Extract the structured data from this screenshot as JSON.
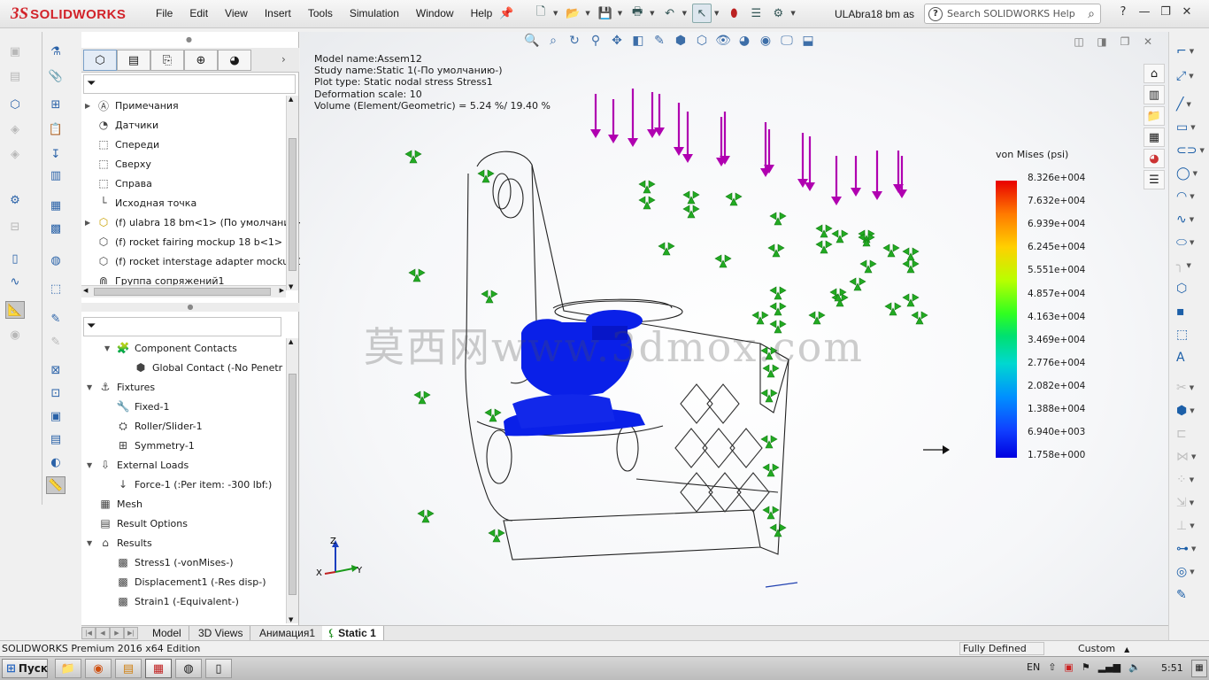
{
  "app": {
    "logo_ds": "3S",
    "logo_text": "SOLIDWORKS",
    "doc_title": "ULAbra18 bm as",
    "search_placeholder": "Search SOLIDWORKS Help"
  },
  "menu": [
    "File",
    "Edit",
    "View",
    "Insert",
    "Tools",
    "Simulation",
    "Window",
    "Help"
  ],
  "feature_tree": {
    "items": [
      {
        "label": "Примечания",
        "icon": "annotations-icon"
      },
      {
        "label": "Датчики",
        "icon": "sensors-icon"
      },
      {
        "label": "Спереди",
        "icon": "plane-icon"
      },
      {
        "label": "Сверху",
        "icon": "plane-icon"
      },
      {
        "label": "Справа",
        "icon": "plane-icon"
      },
      {
        "label": "Исходная точка",
        "icon": "origin-icon"
      },
      {
        "label": "(f) ulabra 18 bm<1> (По умолчанию<",
        "icon": "part-icon"
      },
      {
        "label": "(f) rocket fairing mockup 18 b<1> -> (",
        "icon": "part-icon"
      },
      {
        "label": "(f) rocket interstage adapter mockup 1",
        "icon": "part-icon"
      },
      {
        "label": "Группа сопряжений1",
        "icon": "mates-icon"
      }
    ]
  },
  "sim_tree": {
    "items": [
      {
        "label": "Component Contacts",
        "indent": 1,
        "expand": "▼"
      },
      {
        "label": "Global Contact (-No Penetr",
        "indent": 2,
        "expand": ""
      },
      {
        "label": "Fixtures",
        "indent": 0,
        "expand": "▼"
      },
      {
        "label": "Fixed-1",
        "indent": 1,
        "expand": ""
      },
      {
        "label": "Roller/Slider-1",
        "indent": 1,
        "expand": ""
      },
      {
        "label": "Symmetry-1",
        "indent": 1,
        "expand": ""
      },
      {
        "label": "External Loads",
        "indent": 0,
        "expand": "▼"
      },
      {
        "label": "Force-1 (:Per item: -300 lbf:)",
        "indent": 1,
        "expand": ""
      },
      {
        "label": "Mesh",
        "indent": 0,
        "expand": ""
      },
      {
        "label": "Result Options",
        "indent": 0,
        "expand": ""
      },
      {
        "label": "Results",
        "indent": 0,
        "expand": "▼"
      },
      {
        "label": "Stress1 (-vonMises-)",
        "indent": 1,
        "expand": ""
      },
      {
        "label": "Displacement1 (-Res disp-)",
        "indent": 1,
        "expand": ""
      },
      {
        "label": "Strain1 (-Equivalent-)",
        "indent": 1,
        "expand": ""
      }
    ]
  },
  "study_info": {
    "model_name": "Model name:Assem12",
    "study_name": "Study name:Static 1(-По умолчанию-)",
    "plot_type": "Plot type: Static nodal stress Stress1",
    "deformation": "Deformation scale: 10",
    "volume": "Volume (Element/Geometric) = 5.24 %/ 19.40 %"
  },
  "legend": {
    "title": "von Mises (psi)",
    "labels": [
      "8.326e+004",
      "7.632e+004",
      "6.939e+004",
      "6.245e+004",
      "5.551e+004",
      "4.857e+004",
      "4.163e+004",
      "3.469e+004",
      "2.776e+004",
      "2.082e+004",
      "1.388e+004",
      "6.940e+003",
      "1.758e+000"
    ],
    "colors": {
      "max": "#e80000",
      "mid": "#30ff20",
      "min": "#0000e0"
    }
  },
  "watermark": "莫西网www.3dmox.com",
  "triad": {
    "z": "Z",
    "y": "Y",
    "x": "X"
  },
  "bottom_tabs": [
    {
      "label": "Model",
      "active": false
    },
    {
      "label": "3D Views",
      "active": false
    },
    {
      "label": "Анимация1",
      "active": false
    },
    {
      "label": "Static 1",
      "active": true
    }
  ],
  "status": {
    "edition": "SOLIDWORKS Premium 2016 x64 Edition",
    "defined": "Fully Defined",
    "units": "Custom"
  },
  "taskbar": {
    "start": "Пуск",
    "lang": "EN",
    "time": "5:51"
  },
  "colors": {
    "brand": "#d2232a",
    "load_arrows": "#b000b0",
    "fixtures": "#22aa22",
    "stress_low": "#0a20e8"
  }
}
